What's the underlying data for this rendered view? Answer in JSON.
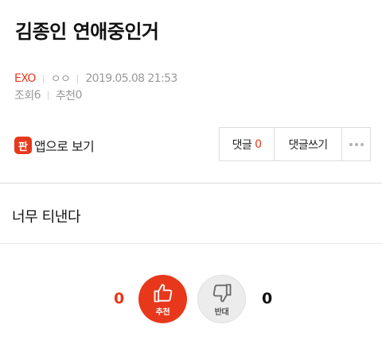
{
  "post": {
    "title": "김종인 연애중인거",
    "board": "EXO",
    "author": "ㅇㅇ",
    "datetime": "2019.05.08 21:53",
    "views_label": "조회",
    "views": "6",
    "recommend_label": "추천",
    "recommend": "0",
    "body": "너무 티낸다"
  },
  "toolbar": {
    "app_icon_glyph": "판",
    "app_view_label": "앱으로 보기",
    "comments_label": "댓글",
    "comments_count": "0",
    "write_comment_label": "댓글쓰기"
  },
  "vote": {
    "up_count": "0",
    "up_label": "추천",
    "down_label": "반대",
    "down_count": "0"
  },
  "colors": {
    "accent": "#e8381b",
    "divider": "#d9d9d9",
    "meta_text": "#999999"
  }
}
